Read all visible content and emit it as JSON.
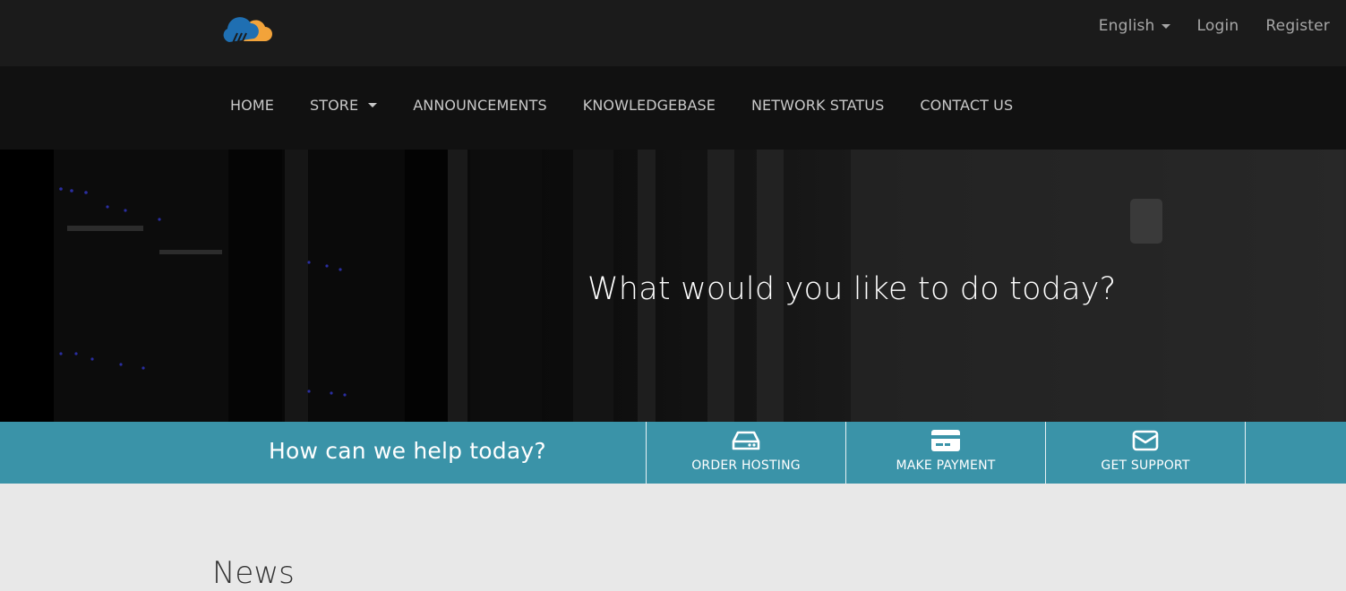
{
  "topbar": {
    "logo_icon": "cloud-logo-icon",
    "language_label": "English",
    "login_label": "Login",
    "register_label": "Register"
  },
  "nav": {
    "items": [
      {
        "label": "HOME"
      },
      {
        "label": "STORE",
        "has_dropdown": true
      },
      {
        "label": "ANNOUNCEMENTS"
      },
      {
        "label": "KNOWLEDGEBASE"
      },
      {
        "label": "NETWORK STATUS"
      },
      {
        "label": "CONTACT US"
      }
    ]
  },
  "hero": {
    "title": "What would you like to do today?"
  },
  "help": {
    "title": "How can we help today?",
    "actions": [
      {
        "label": "ORDER HOSTING",
        "icon": "server-icon"
      },
      {
        "label": "MAKE PAYMENT",
        "icon": "credit-card-icon"
      },
      {
        "label": "GET SUPPORT",
        "icon": "envelope-icon"
      }
    ]
  },
  "main": {
    "news_title": "News"
  },
  "colors": {
    "topbar": "#1b1b1b",
    "navbar": "#111111",
    "accent": "#3a93a8",
    "logo_blue": "#1f6fb2",
    "logo_orange": "#f2a33a",
    "page_bg": "#e8e8e8"
  }
}
